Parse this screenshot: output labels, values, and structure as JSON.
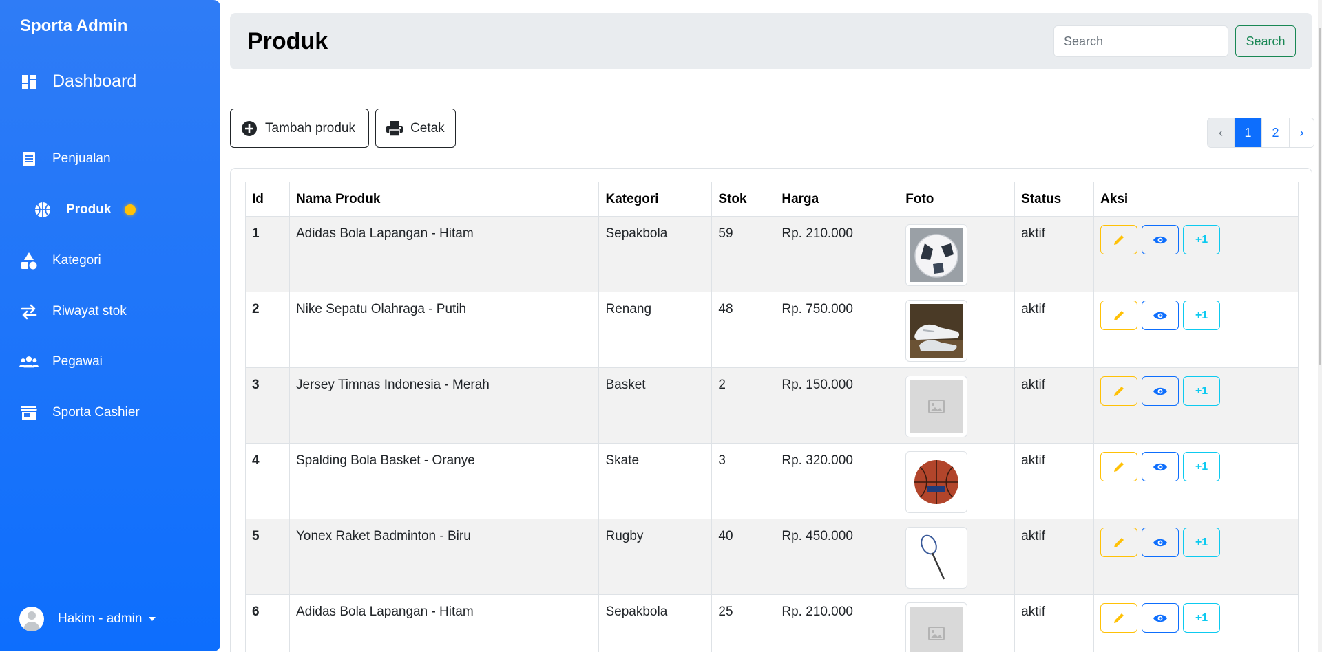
{
  "sidebar": {
    "brand": "Sporta Admin",
    "items": [
      {
        "label": "Dashboard",
        "icon": "dashboard-icon"
      },
      {
        "label": "Penjualan",
        "icon": "receipt-icon"
      },
      {
        "label": "Produk",
        "icon": "basketball-icon",
        "active": true
      },
      {
        "label": "Kategori",
        "icon": "shapes-icon"
      },
      {
        "label": "Riwayat stok",
        "icon": "exchange-icon"
      },
      {
        "label": "Pegawai",
        "icon": "users-icon"
      },
      {
        "label": "Sporta Cashier",
        "icon": "store-icon"
      }
    ],
    "user": {
      "name": "Hakim - admin",
      "icon": "user-avatar"
    }
  },
  "header": {
    "title": "Produk",
    "search": {
      "placeholder": "Search",
      "value": "",
      "button_label": "Search"
    }
  },
  "toolbar": {
    "add_label": "Tambah produk",
    "print_label": "Cetak"
  },
  "pagination": {
    "prev": "‹",
    "pages": [
      "1",
      "2"
    ],
    "current": "1",
    "next": "›"
  },
  "table": {
    "columns": [
      "Id",
      "Nama Produk",
      "Kategori",
      "Stok",
      "Harga",
      "Foto",
      "Status",
      "Aksi"
    ],
    "rows": [
      {
        "id": "1",
        "name": "Adidas Bola Lapangan - Hitam",
        "category": "Sepakbola",
        "stock": "59",
        "price": "Rp. 210.000",
        "photo": "soccer-ball-photo",
        "status": "aktif"
      },
      {
        "id": "2",
        "name": "Nike Sepatu Olahraga - Putih",
        "category": "Renang",
        "stock": "48",
        "price": "Rp. 750.000",
        "photo": "sneaker-photo",
        "status": "aktif"
      },
      {
        "id": "3",
        "name": "Jersey Timnas Indonesia - Merah",
        "category": "Basket",
        "stock": "2",
        "price": "Rp. 150.000",
        "photo": "placeholder-image",
        "status": "aktif"
      },
      {
        "id": "4",
        "name": "Spalding Bola Basket - Oranye",
        "category": "Skate",
        "stock": "3",
        "price": "Rp. 320.000",
        "photo": "basketball-photo",
        "status": "aktif"
      },
      {
        "id": "5",
        "name": "Yonex Raket Badminton - Biru",
        "category": "Rugby",
        "stock": "40",
        "price": "Rp. 450.000",
        "photo": "racket-photo",
        "status": "aktif"
      },
      {
        "id": "6",
        "name": "Adidas Bola Lapangan - Hitam",
        "category": "Sepakbola",
        "stock": "25",
        "price": "Rp. 210.000",
        "photo": "placeholder-image",
        "status": "aktif"
      }
    ],
    "action_labels": {
      "edit": "pencil-icon",
      "view": "eye-icon",
      "plus": "+1"
    }
  },
  "colors": {
    "sidebar": "#0d6efd",
    "accent_yellow": "#ffc107",
    "primary": "#0d6efd",
    "info": "#0dcaf0",
    "success": "#198754"
  }
}
